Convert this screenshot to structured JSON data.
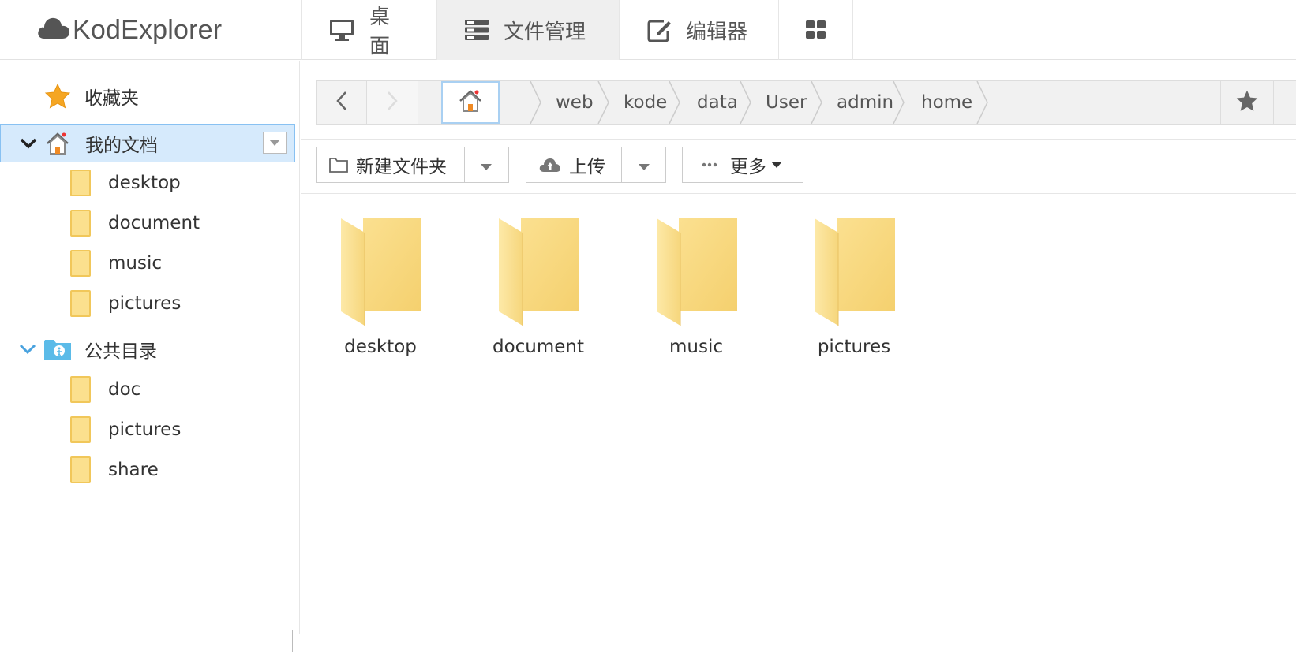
{
  "app": {
    "logo_text": "KodExplorer"
  },
  "nav": {
    "desktop": "桌面",
    "file_manager": "文件管理",
    "editor": "编辑器"
  },
  "sidebar": {
    "favorites": "收藏夹",
    "my_docs": {
      "label": "我的文档",
      "children": [
        "desktop",
        "document",
        "music",
        "pictures"
      ]
    },
    "public": {
      "label": "公共目录",
      "children": [
        "doc",
        "pictures",
        "share"
      ]
    }
  },
  "address": {
    "crumbs": [
      "web",
      "kode",
      "data",
      "User",
      "admin",
      "home"
    ]
  },
  "toolbar": {
    "new_folder": "新建文件夹",
    "upload": "上传",
    "more": "更多"
  },
  "files": [
    "desktop",
    "document",
    "music",
    "pictures"
  ],
  "colors": {
    "accent": "#88c1f2",
    "selected_bg": "#d6eafc",
    "folder": "#fbe08e",
    "star": "#f5a623"
  }
}
